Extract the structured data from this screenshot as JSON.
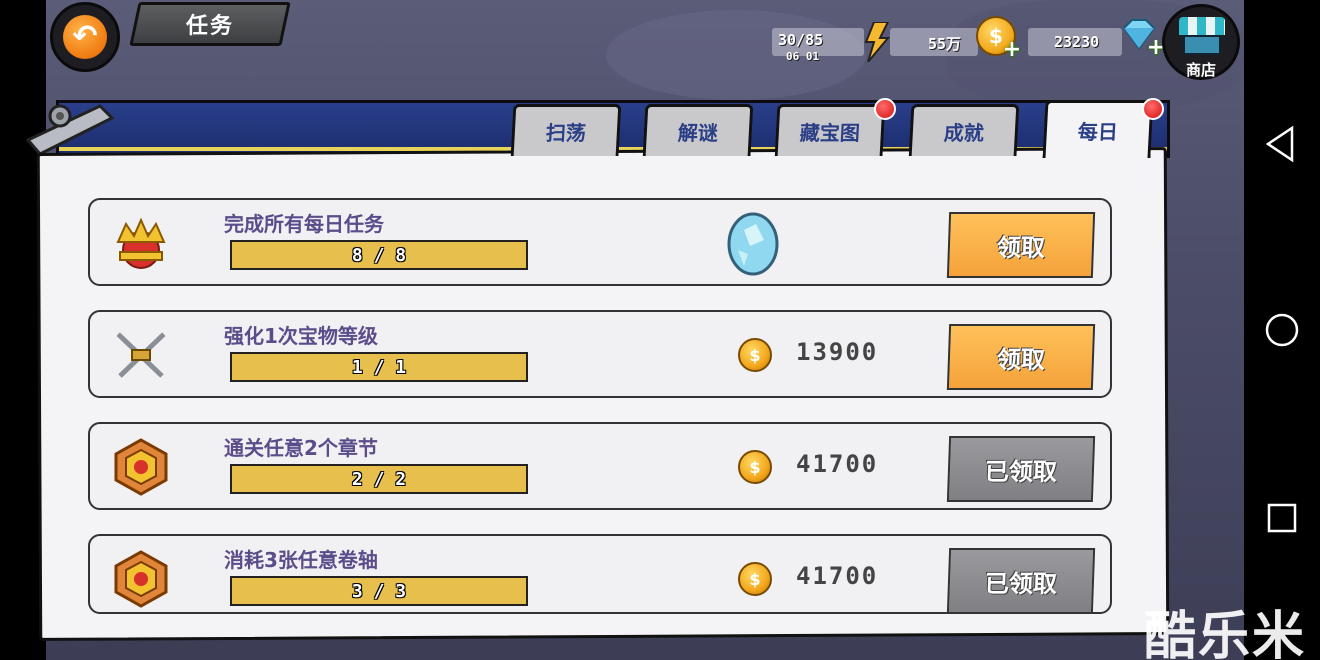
{
  "header": {
    "title": "任务",
    "energy": {
      "value": "30/85",
      "timer": "06 01"
    },
    "gold": {
      "value": "55万"
    },
    "gems": {
      "value": "23230"
    },
    "shop_label": "商店"
  },
  "tabs": [
    {
      "label": "扫荡",
      "active": false,
      "badge": false
    },
    {
      "label": "解谜",
      "active": false,
      "badge": false
    },
    {
      "label": "藏宝图",
      "active": false,
      "badge": true
    },
    {
      "label": "成就",
      "active": false,
      "badge": false
    },
    {
      "label": "每日",
      "active": true,
      "badge": true
    }
  ],
  "quests": [
    {
      "name": "完成所有每日任务",
      "progress": "8 / 8",
      "reward_type": "egg",
      "reward_amount": "",
      "button": "领取",
      "status": "ready",
      "icon": "crown-icon"
    },
    {
      "name": "强化1次宝物等级",
      "progress": "1 / 1",
      "reward_type": "coin",
      "reward_amount": "13900",
      "button": "领取",
      "status": "ready",
      "icon": "crossed-swords-icon"
    },
    {
      "name": "通关任意2个章节",
      "progress": "2 / 2",
      "reward_type": "coin",
      "reward_amount": "41700",
      "button": "已领取",
      "status": "done",
      "icon": "medal-icon"
    },
    {
      "name": "消耗3张任意卷轴",
      "progress": "3 / 3",
      "reward_type": "coin",
      "reward_amount": "41700",
      "button": "已领取",
      "status": "done",
      "icon": "medal-icon"
    }
  ],
  "watermark": "酷乐米",
  "colors": {
    "accent_orange": "#f5a23a",
    "done_gray": "#8a8a8e",
    "progress_gold": "#e6bf4d",
    "header_blue": "#1c2d6c",
    "tab_text": "#2b3f86"
  }
}
